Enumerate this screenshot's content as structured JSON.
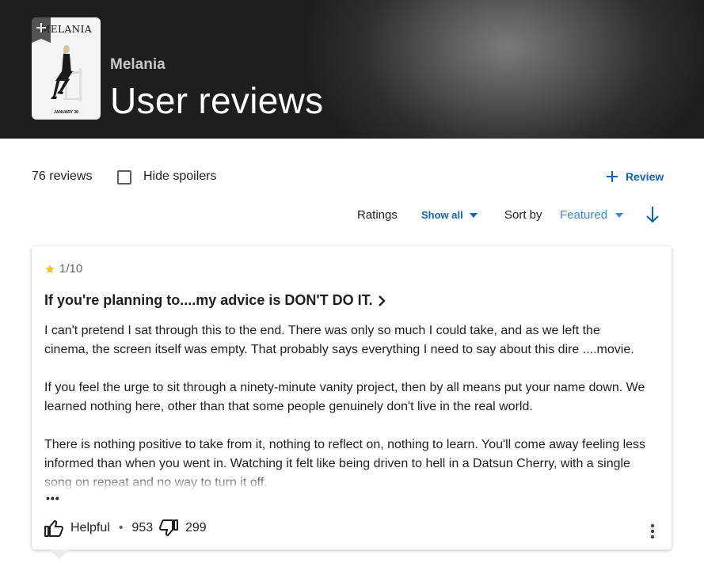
{
  "header": {
    "subtitle": "Melania",
    "title": "User reviews",
    "poster": {
      "title_text": "MELANIA",
      "date_text": "JANUARY 30",
      "ribbon_icon": "plus-icon"
    }
  },
  "toolbar": {
    "reviews_count": "76 reviews",
    "hide_spoilers_label": "Hide spoilers",
    "hide_spoilers_checked": false,
    "review_button_label": "Review",
    "ratings_label": "Ratings",
    "ratings_value": "Show all",
    "sort_label": "Sort by",
    "sort_value": "Featured"
  },
  "review": {
    "rating": "1/10",
    "title": "If you're planning to....my advice is DON'T DO IT.",
    "paragraphs": [
      "I can't pretend I sat through this to the end. There was only so much I could take, and as we left the cinema, the screen itself was empty. That probably says everything I need to say about this dire ....movie.",
      "If you feel the urge to sit through a ninety-minute vanity project, then by all means put your name down. We learned nothing here, other than that some people genuinely don't live in the real world.",
      "There is nothing positive to take from it, nothing to reflect on, nothing to learn. You'll come away feeling less informed than when you went in. Watching it felt like being driven to hell in a Datsun Cherry, with a single song on repeat and no way to turn it off."
    ],
    "expand_glyph": "•••",
    "helpful_label": "Helpful",
    "separator": "•",
    "helpful_count": "953",
    "unhelpful_count": "299"
  },
  "colors": {
    "accent": "#0e63be",
    "sort_value": "#3d86d4",
    "star": "#f5c518",
    "hero_bg": "#2e2e2e"
  }
}
